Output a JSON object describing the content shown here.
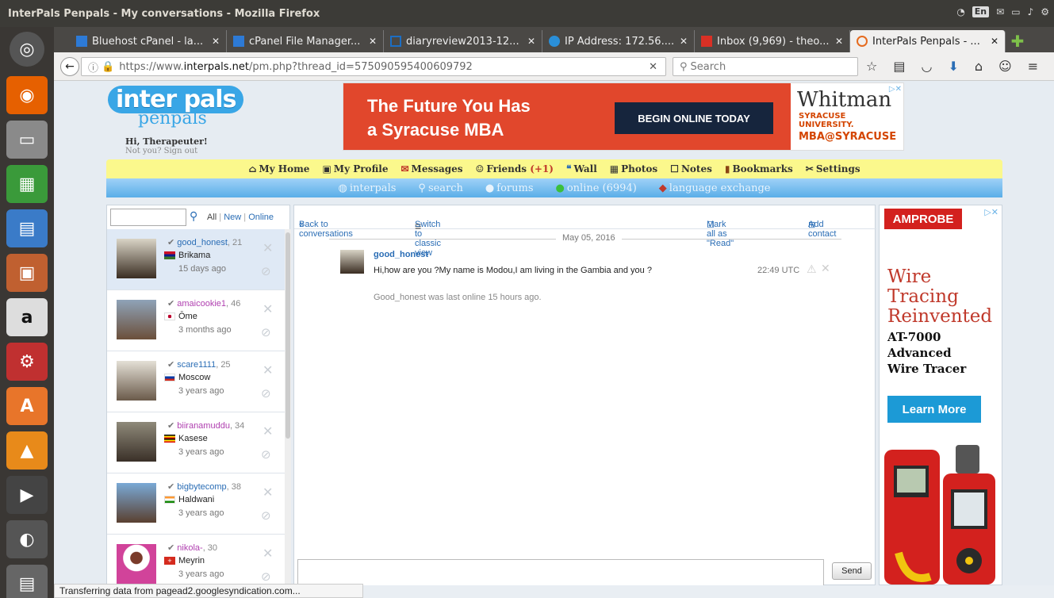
{
  "window": {
    "title": "InterPals Penpals - My conversations - Mozilla Firefox"
  },
  "system": {
    "keyboard": "En"
  },
  "browser": {
    "tabs": [
      {
        "label": "Bluehost cPanel - la...",
        "color": "#2d7ad6"
      },
      {
        "label": "cPanel File Manager...",
        "color": "#2d7ad6"
      },
      {
        "label": "diaryreview2013-12...",
        "color": "#1c6ec4"
      },
      {
        "label": "IP Address: 172.56....",
        "color": "#2a8fd8"
      },
      {
        "label": "Inbox (9,969) - theo...",
        "color": "#d93025"
      },
      {
        "label": "InterPals Penpals - ...",
        "color": "#e56b1f"
      }
    ],
    "url_prefix": "https://www.",
    "url_domain": "interpals.net",
    "url_path": "/pm.php?thread_id=575090595400609792",
    "search_placeholder": "Search"
  },
  "site": {
    "logo_top": "inter pals",
    "logo_bottom": "penpals",
    "greeting": "Hi, Therapeuter!",
    "signout": "Not you? Sign out"
  },
  "banner": {
    "headline_1": "The Future You Has",
    "headline_2": "a Syracuse MBA",
    "cta": "BEGIN ONLINE TODAY",
    "brand": "Whitman",
    "sub": "SYRACUSE UNIVERSITY.",
    "mba": "MBA@SYRACUSE"
  },
  "menu": {
    "items": [
      {
        "label": "My Home"
      },
      {
        "label": "My Profile"
      },
      {
        "label": "Messages"
      },
      {
        "label": "Friends"
      },
      {
        "label": "Wall"
      },
      {
        "label": "Photos"
      },
      {
        "label": "Notes"
      },
      {
        "label": "Bookmarks"
      },
      {
        "label": "Settings"
      }
    ],
    "friends_count": "(+1)"
  },
  "submenu": {
    "items": [
      {
        "label": "interpals"
      },
      {
        "label": "search"
      },
      {
        "label": "forums"
      },
      {
        "label": "online (6994)"
      },
      {
        "label": "language exchange"
      }
    ]
  },
  "filters": {
    "all": "All",
    "new": "New",
    "online": "Online"
  },
  "conversations": [
    {
      "user": "good_honest",
      "age": ", 21",
      "location": "Brikama",
      "ago": "15 days ago",
      "flag": "gm",
      "selected": true
    },
    {
      "user": "amaicookie1",
      "age": ", 46",
      "location": "Ōme",
      "ago": "3 months ago",
      "flag": "jp",
      "selected": false
    },
    {
      "user": "scare1111",
      "age": ", 25",
      "location": "Moscow",
      "ago": "3 years ago",
      "flag": "ru",
      "selected": false
    },
    {
      "user": "biiranamuddu",
      "age": ", 34",
      "location": "Kasese",
      "ago": "3 years ago",
      "flag": "ug",
      "selected": false
    },
    {
      "user": "bigbytecomp",
      "age": ", 38",
      "location": "Haldwani",
      "ago": "3 years ago",
      "flag": "in",
      "selected": false
    },
    {
      "user": "nikola-",
      "age": ", 30",
      "location": "Meyrin",
      "ago": "3 years ago",
      "flag": "ch",
      "selected": false
    }
  ],
  "thread": {
    "back": "Back to conversations",
    "classic": "Switch to classic view",
    "mark_read": "Mark all as \"Read\"",
    "add_contact": "Add contact",
    "date": "May 05, 2016",
    "sender": "good_honest",
    "message": "Hi,how are you ?My name is Modou,I am living in the Gambia and you ?",
    "time": "22:49 UTC",
    "last_online": "Good_honest was last online 15 hours ago.",
    "send": "Send"
  },
  "right_ad": {
    "brand": "AMPROBE",
    "headline_1": "Wire",
    "headline_2": "Tracing",
    "headline_3": "Reinvented",
    "model_1": "AT-7000",
    "model_2": "Advanced",
    "model_3": "Wire Tracer",
    "cta": "Learn More"
  },
  "status": {
    "text": "Transferring data from pagead2.googlesyndication.com..."
  },
  "colors": {
    "link": "#2a6db5",
    "menu_yellow": "#fbf88c",
    "menu_blue": "#5aaee8",
    "ad_orange": "#e1472c"
  }
}
